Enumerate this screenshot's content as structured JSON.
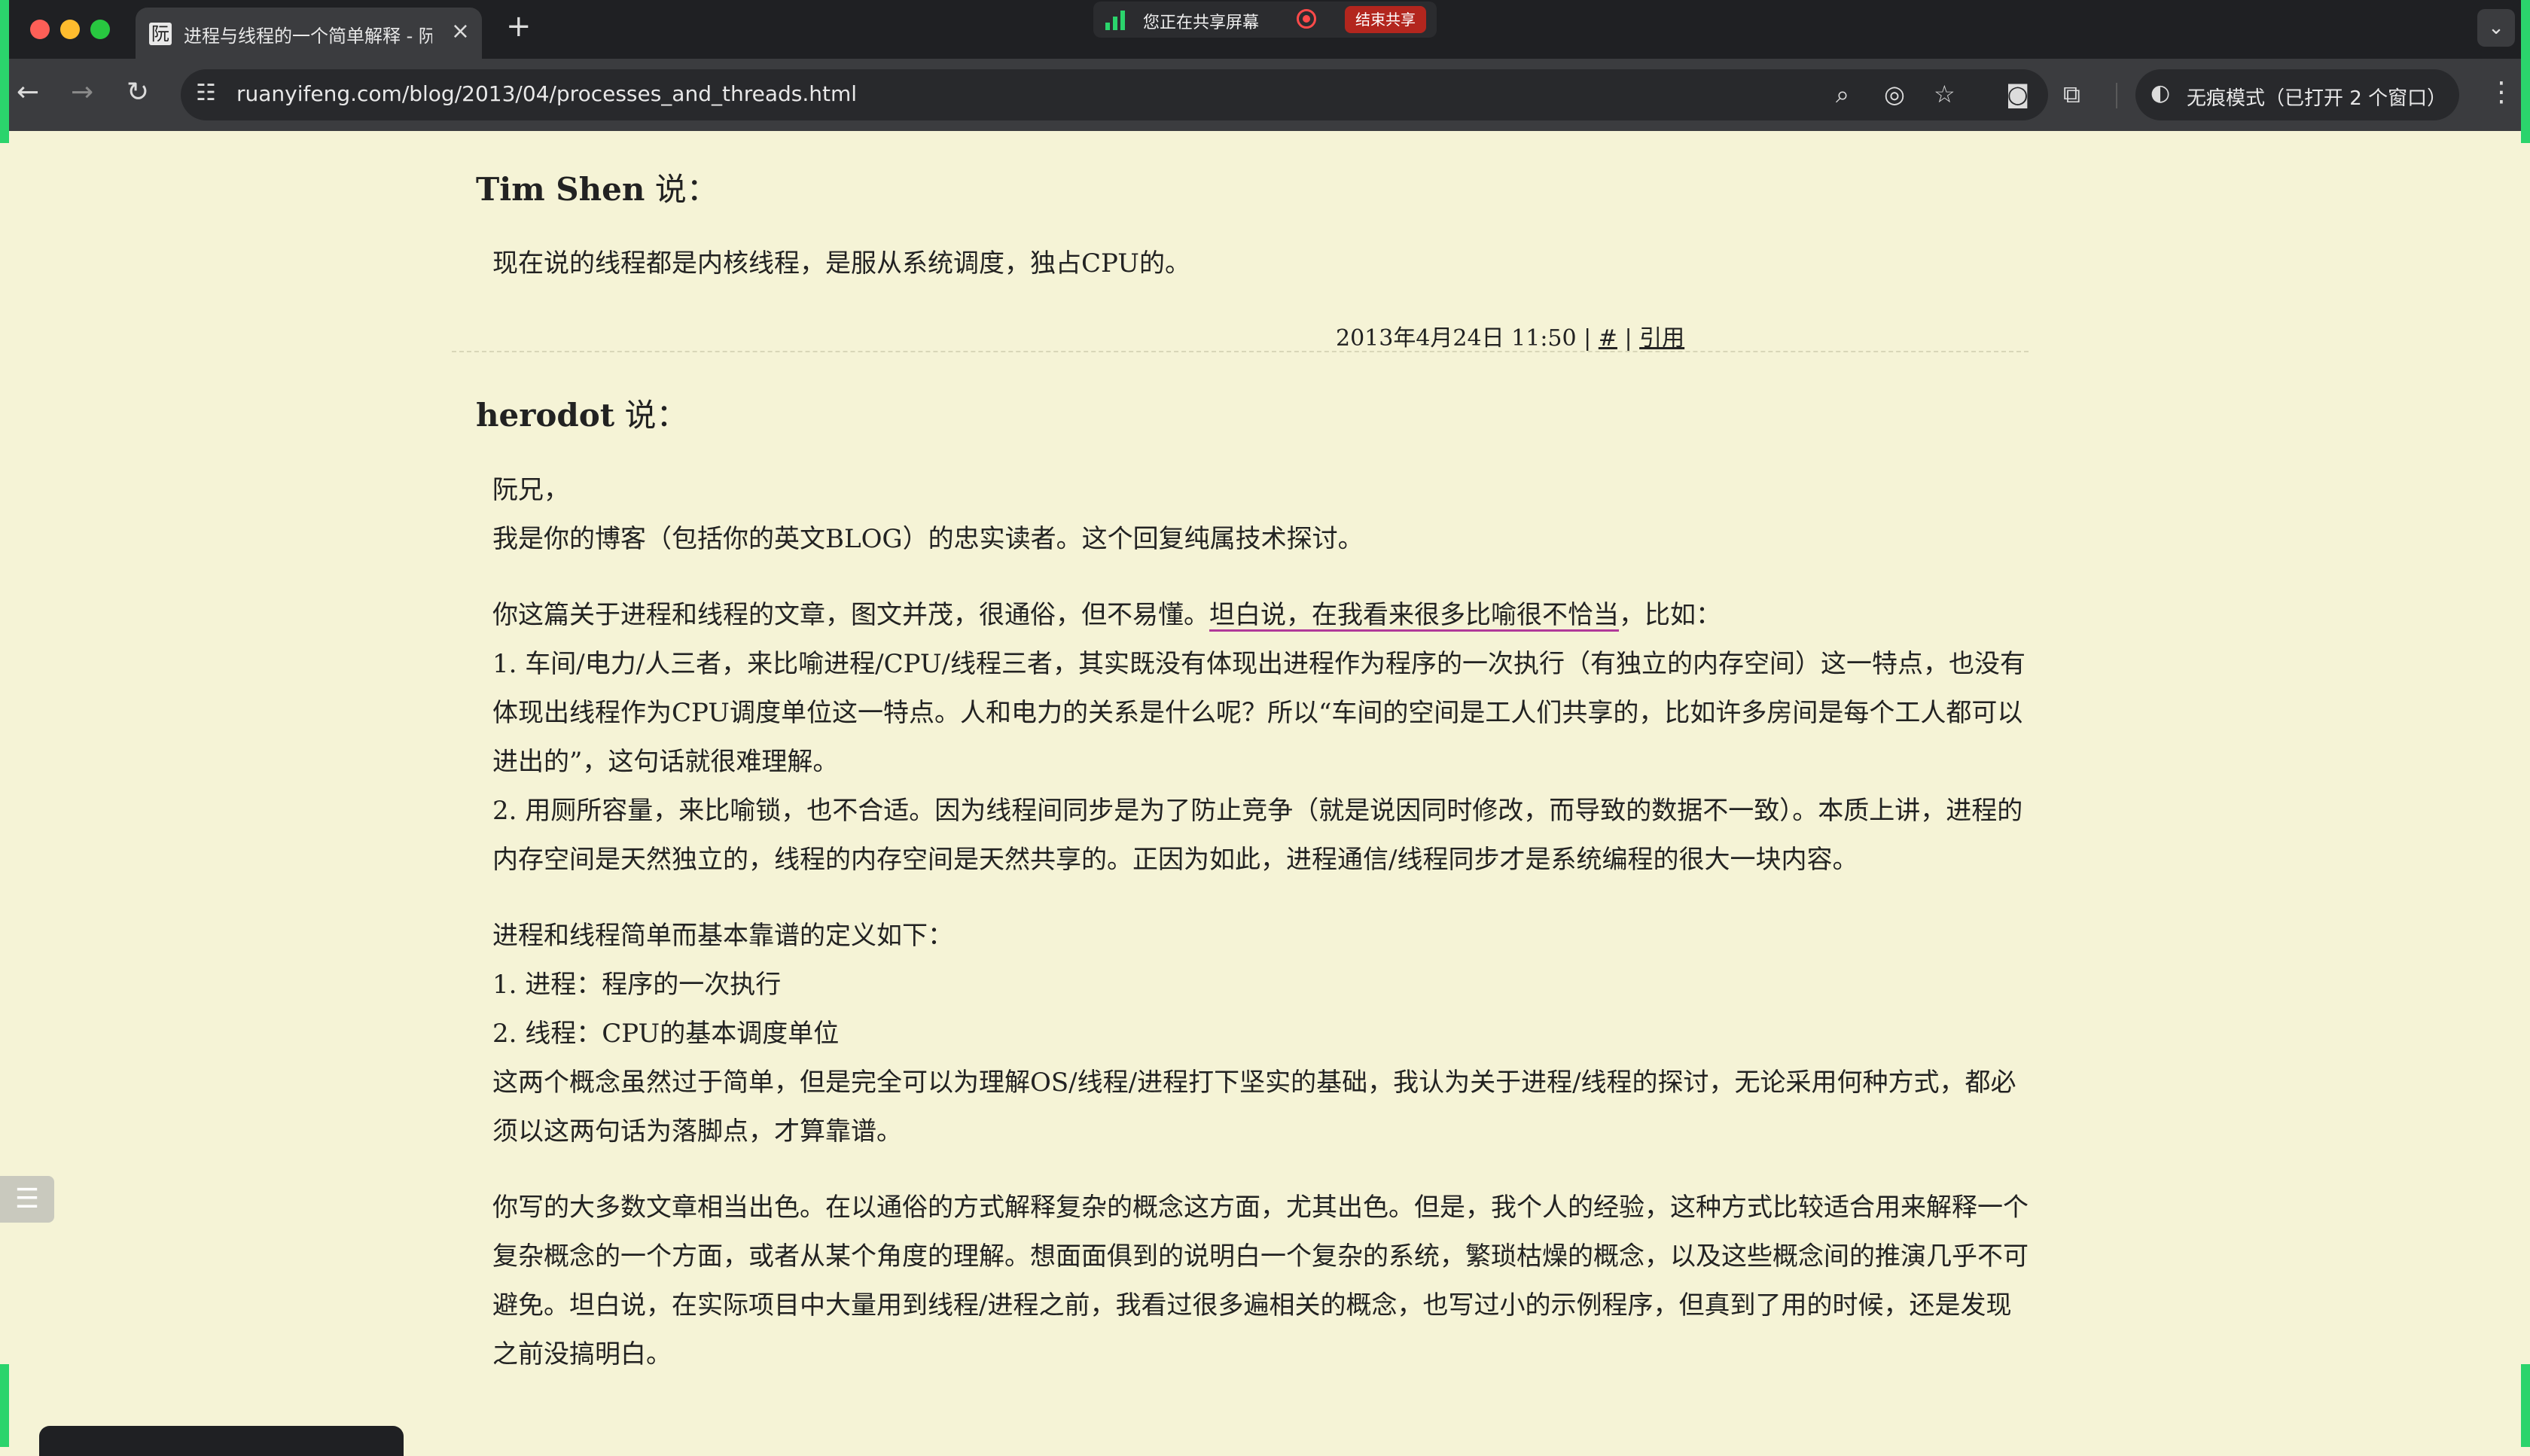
{
  "browser": {
    "tab_title": "进程与线程的一个简单解释 - 阮",
    "favicon_glyph": "阮",
    "new_tab_label": "+",
    "close_tab_label": "×",
    "share_notice": "您正在共享屏幕",
    "share_end_label": "结束共享",
    "url": "ruanyifeng.com/blog/2013/04/processes_and_threads.html",
    "incognito_label": "无痕模式（已打开 2 个窗口）"
  },
  "icons": {
    "back": "back-arrow-icon",
    "forward": "forward-arrow-icon",
    "reload": "reload-icon",
    "site_info": "site-info-icon",
    "zoom": "zoom-icon",
    "eye": "eye-off-icon",
    "star": "bookmark-star-icon",
    "camera": "camera-icon",
    "extensions": "extensions-icon",
    "incognito": "incognito-icon",
    "menu": "kebab-menu-icon",
    "toc": "table-of-contents-icon"
  },
  "comments": [
    {
      "author": "Tim Shen",
      "says": " 说：",
      "paragraphs": [
        "现在说的线程都是内核线程，是服从系统调度，独占CPU的。"
      ],
      "date": "2013年4月24日 11:50",
      "sep1": " | ",
      "permalink": "#",
      "sep2": " | ",
      "reply": "引用"
    },
    {
      "author": "herodot",
      "says": " 说：",
      "p1_line1": "阮兄，",
      "p1_line2": "我是你的博客（包括你的英文BLOG）的忠实读者。这个回复纯属技术探讨。",
      "p2_prefix": "你这篇关于进程和线程的文章，图文并茂，很通俗，但不易懂。",
      "p2_highlight": "坦白说，在我看来很多比喻很不恰当",
      "p2_suffix": "，比如：",
      "p2_item1": "1. 车间/电力/人三者，来比喻进程/CPU/线程三者，其实既没有体现出进程作为程序的一次执行（有独立的内存空间）这一特点，也没有体现出线程作为CPU调度单位这一特点。人和电力的关系是什么呢？所以“车间的空间是工人们共享的，比如许多房间是每个工人都可以进出的”，这句话就很难理解。",
      "p2_item2": "2. 用厕所容量，来比喻锁，也不合适。因为线程间同步是为了防止竞争（就是说因同时修改，而导致的数据不一致）。本质上讲，进程的内存空间是天然独立的，线程的内存空间是天然共享的。正因为如此，进程通信/线程同步才是系统编程的很大一块内容。",
      "p3_line1": "进程和线程简单而基本靠谱的定义如下：",
      "p3_line2": "1. 进程：程序的一次执行",
      "p3_line3": "2. 线程：CPU的基本调度单位",
      "p3_line4": "这两个概念虽然过于简单，但是完全可以为理解OS/线程/进程打下坚实的基础，我认为关于进程/线程的探讨，无论采用何种方式，都必须以这两句话为落脚点，才算靠谱。",
      "p4": "你写的大多数文章相当出色。在以通俗的方式解释复杂的概念这方面，尤其出色。但是，我个人的经验，这种方式比较适合用来解释一个复杂概念的一个方面，或者从某个角度的理解。想面面俱到的说明白一个复杂的系统，繁琐枯燥的概念，以及这些概念间的推演几乎不可避免。坦白说，在实际项目中大量用到线程/进程之前，我看过很多遍相关的概念，也写过小的示例程序，但真到了用的时候，还是发现之前没搞明白。"
    }
  ],
  "colors": {
    "page_background": "#f5f3d6",
    "share_border": "#2bd46c",
    "highlight_underline": "#b0389a",
    "share_end": "#b3261e"
  }
}
